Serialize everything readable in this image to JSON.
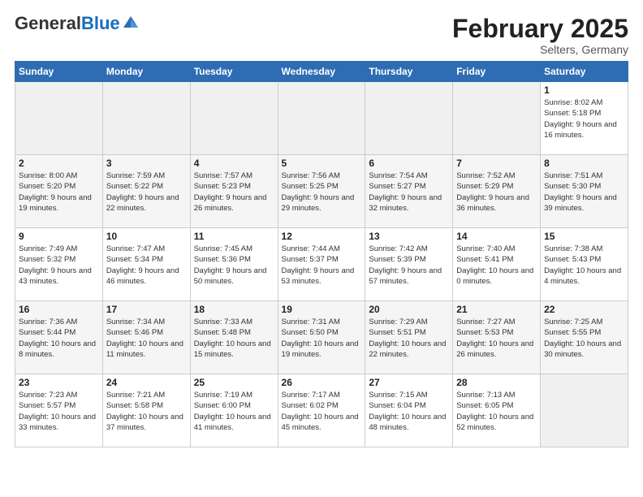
{
  "header": {
    "logo_general": "General",
    "logo_blue": "Blue",
    "month_title": "February 2025",
    "location": "Selters, Germany"
  },
  "days_of_week": [
    "Sunday",
    "Monday",
    "Tuesday",
    "Wednesday",
    "Thursday",
    "Friday",
    "Saturday"
  ],
  "weeks": [
    [
      {
        "day": "",
        "info": ""
      },
      {
        "day": "",
        "info": ""
      },
      {
        "day": "",
        "info": ""
      },
      {
        "day": "",
        "info": ""
      },
      {
        "day": "",
        "info": ""
      },
      {
        "day": "",
        "info": ""
      },
      {
        "day": "1",
        "info": "Sunrise: 8:02 AM\nSunset: 5:18 PM\nDaylight: 9 hours and 16 minutes."
      }
    ],
    [
      {
        "day": "2",
        "info": "Sunrise: 8:00 AM\nSunset: 5:20 PM\nDaylight: 9 hours and 19 minutes."
      },
      {
        "day": "3",
        "info": "Sunrise: 7:59 AM\nSunset: 5:22 PM\nDaylight: 9 hours and 22 minutes."
      },
      {
        "day": "4",
        "info": "Sunrise: 7:57 AM\nSunset: 5:23 PM\nDaylight: 9 hours and 26 minutes."
      },
      {
        "day": "5",
        "info": "Sunrise: 7:56 AM\nSunset: 5:25 PM\nDaylight: 9 hours and 29 minutes."
      },
      {
        "day": "6",
        "info": "Sunrise: 7:54 AM\nSunset: 5:27 PM\nDaylight: 9 hours and 32 minutes."
      },
      {
        "day": "7",
        "info": "Sunrise: 7:52 AM\nSunset: 5:29 PM\nDaylight: 9 hours and 36 minutes."
      },
      {
        "day": "8",
        "info": "Sunrise: 7:51 AM\nSunset: 5:30 PM\nDaylight: 9 hours and 39 minutes."
      }
    ],
    [
      {
        "day": "9",
        "info": "Sunrise: 7:49 AM\nSunset: 5:32 PM\nDaylight: 9 hours and 43 minutes."
      },
      {
        "day": "10",
        "info": "Sunrise: 7:47 AM\nSunset: 5:34 PM\nDaylight: 9 hours and 46 minutes."
      },
      {
        "day": "11",
        "info": "Sunrise: 7:45 AM\nSunset: 5:36 PM\nDaylight: 9 hours and 50 minutes."
      },
      {
        "day": "12",
        "info": "Sunrise: 7:44 AM\nSunset: 5:37 PM\nDaylight: 9 hours and 53 minutes."
      },
      {
        "day": "13",
        "info": "Sunrise: 7:42 AM\nSunset: 5:39 PM\nDaylight: 9 hours and 57 minutes."
      },
      {
        "day": "14",
        "info": "Sunrise: 7:40 AM\nSunset: 5:41 PM\nDaylight: 10 hours and 0 minutes."
      },
      {
        "day": "15",
        "info": "Sunrise: 7:38 AM\nSunset: 5:43 PM\nDaylight: 10 hours and 4 minutes."
      }
    ],
    [
      {
        "day": "16",
        "info": "Sunrise: 7:36 AM\nSunset: 5:44 PM\nDaylight: 10 hours and 8 minutes."
      },
      {
        "day": "17",
        "info": "Sunrise: 7:34 AM\nSunset: 5:46 PM\nDaylight: 10 hours and 11 minutes."
      },
      {
        "day": "18",
        "info": "Sunrise: 7:33 AM\nSunset: 5:48 PM\nDaylight: 10 hours and 15 minutes."
      },
      {
        "day": "19",
        "info": "Sunrise: 7:31 AM\nSunset: 5:50 PM\nDaylight: 10 hours and 19 minutes."
      },
      {
        "day": "20",
        "info": "Sunrise: 7:29 AM\nSunset: 5:51 PM\nDaylight: 10 hours and 22 minutes."
      },
      {
        "day": "21",
        "info": "Sunrise: 7:27 AM\nSunset: 5:53 PM\nDaylight: 10 hours and 26 minutes."
      },
      {
        "day": "22",
        "info": "Sunrise: 7:25 AM\nSunset: 5:55 PM\nDaylight: 10 hours and 30 minutes."
      }
    ],
    [
      {
        "day": "23",
        "info": "Sunrise: 7:23 AM\nSunset: 5:57 PM\nDaylight: 10 hours and 33 minutes."
      },
      {
        "day": "24",
        "info": "Sunrise: 7:21 AM\nSunset: 5:58 PM\nDaylight: 10 hours and 37 minutes."
      },
      {
        "day": "25",
        "info": "Sunrise: 7:19 AM\nSunset: 6:00 PM\nDaylight: 10 hours and 41 minutes."
      },
      {
        "day": "26",
        "info": "Sunrise: 7:17 AM\nSunset: 6:02 PM\nDaylight: 10 hours and 45 minutes."
      },
      {
        "day": "27",
        "info": "Sunrise: 7:15 AM\nSunset: 6:04 PM\nDaylight: 10 hours and 48 minutes."
      },
      {
        "day": "28",
        "info": "Sunrise: 7:13 AM\nSunset: 6:05 PM\nDaylight: 10 hours and 52 minutes."
      },
      {
        "day": "",
        "info": ""
      }
    ]
  ]
}
